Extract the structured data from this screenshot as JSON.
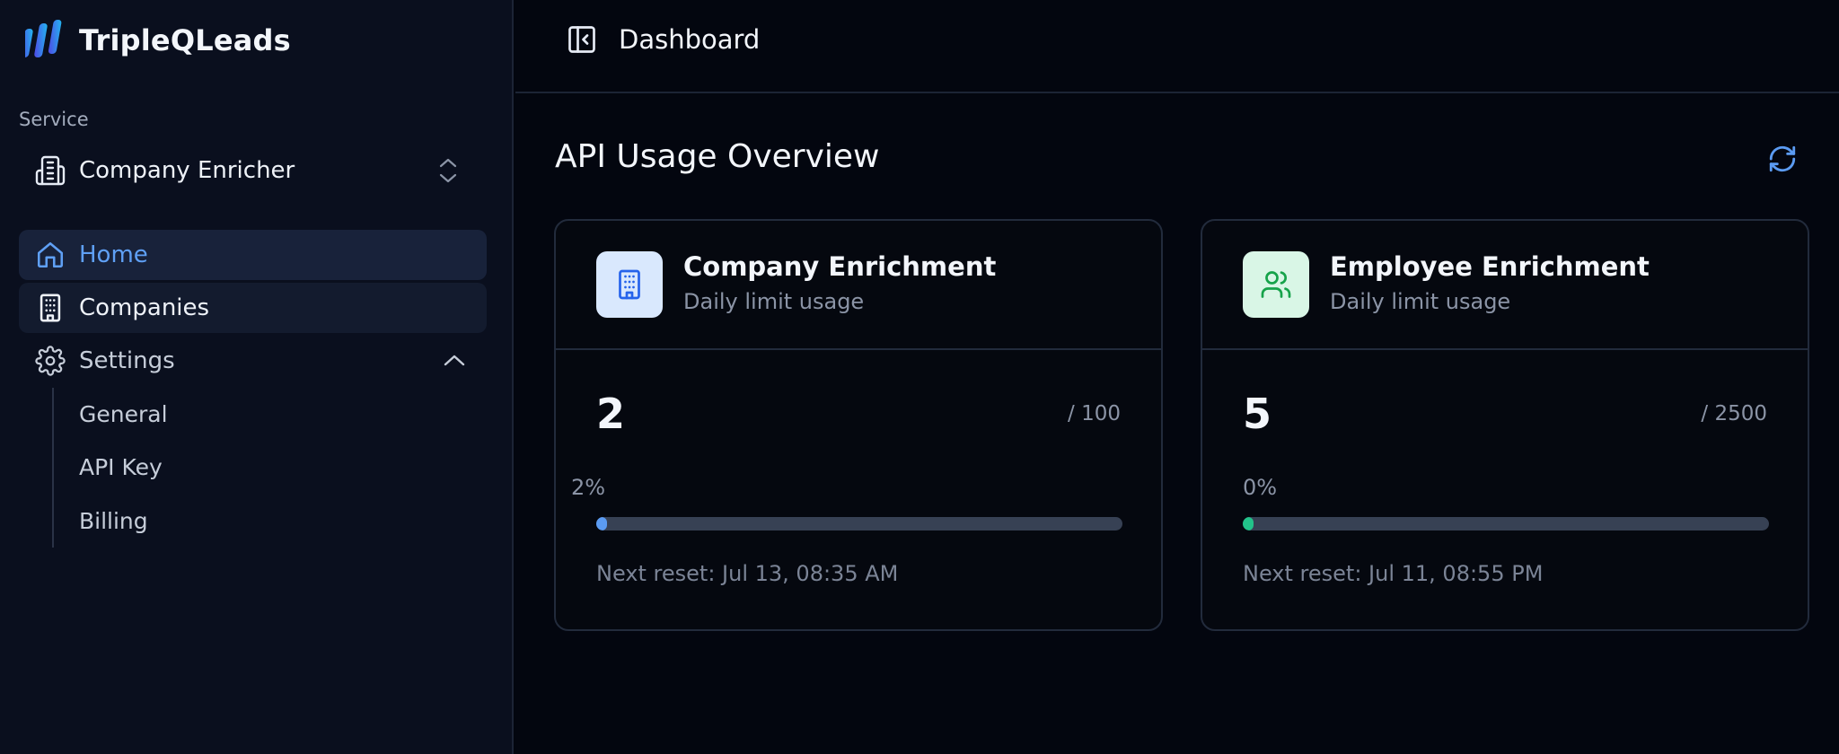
{
  "brand": {
    "name": "TripleQLeads"
  },
  "sidebar": {
    "service_label": "Service",
    "service_select": {
      "value": "Company Enricher"
    },
    "nav": [
      {
        "label": "Home",
        "icon": "home-icon",
        "active": true
      },
      {
        "label": "Companies",
        "icon": "building-icon"
      },
      {
        "label": "Settings",
        "icon": "gear-icon",
        "expanded": true
      }
    ],
    "settings_sub": [
      {
        "label": "General"
      },
      {
        "label": "API Key"
      },
      {
        "label": "Billing"
      }
    ]
  },
  "header": {
    "title": "Dashboard"
  },
  "main": {
    "title": "API Usage Overview",
    "cards": [
      {
        "title": "Company Enrichment",
        "subtitle": "Daily limit usage",
        "value": "2",
        "limit": "/ 100",
        "percent_label": "2%",
        "progress_fraction": 0.02,
        "reset": "Next reset: Jul 13, 08:35 AM",
        "icon": "building-icon"
      },
      {
        "title": "Employee Enrichment",
        "subtitle": "Daily limit usage",
        "value": "5",
        "limit": "/ 2500",
        "percent_label": "0%",
        "progress_fraction": 0.002,
        "reset": "Next reset: Jul 11, 08:55 PM",
        "icon": "users-icon"
      }
    ]
  },
  "colors": {
    "accent": "#5b9bf2",
    "background": "#03060f",
    "sidebar": "#0a0f1e",
    "green": "#22c38a"
  }
}
